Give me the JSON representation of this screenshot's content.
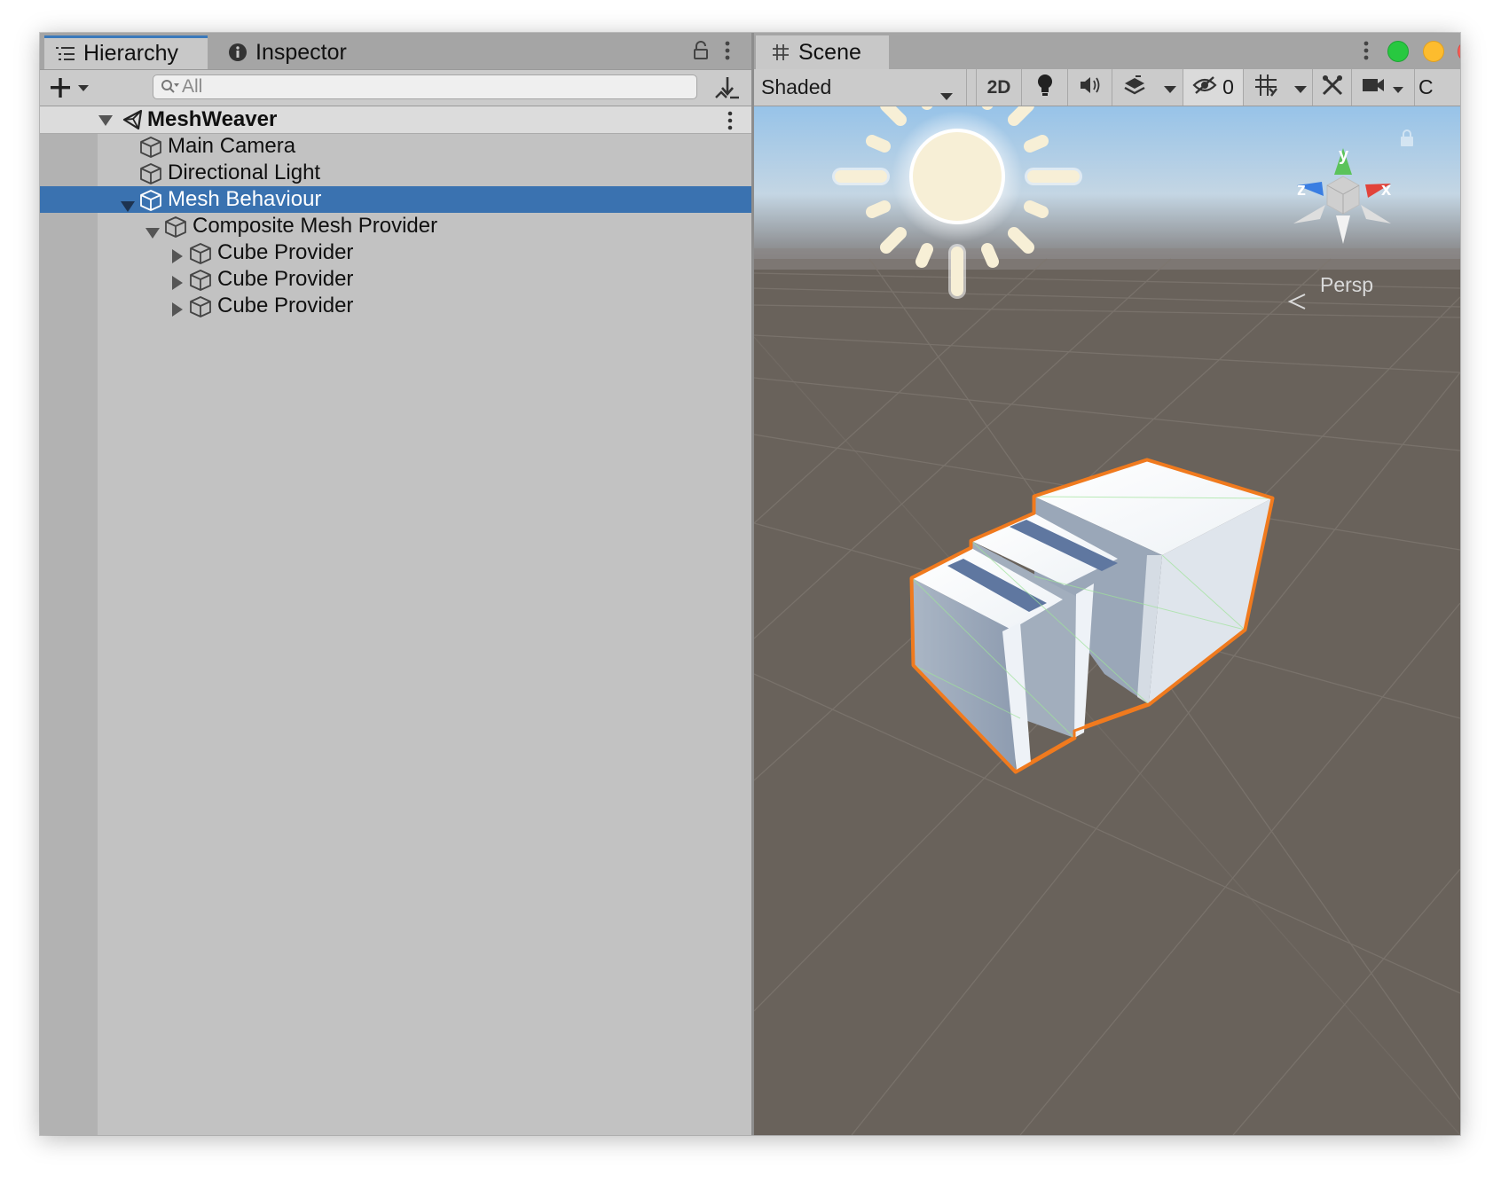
{
  "hierarchy_tab": {
    "label": "Hierarchy",
    "icon": "hierarchy-list-icon"
  },
  "inspector_tab": {
    "label": "Inspector",
    "icon": "info-icon"
  },
  "search": {
    "placeholder": "All"
  },
  "scene_tab": {
    "label": "Scene",
    "icon": "grid-icon"
  },
  "tree": {
    "scene_name": "MeshWeaver",
    "items": [
      {
        "label": "Main Camera"
      },
      {
        "label": "Directional Light"
      },
      {
        "label": "Mesh Behaviour",
        "selected": true,
        "expanded": true
      },
      {
        "label": "Composite Mesh Provider",
        "expanded": true
      },
      {
        "label": "Cube Provider",
        "expanded": false
      },
      {
        "label": "Cube Provider",
        "expanded": false
      },
      {
        "label": "Cube Provider",
        "expanded": false
      }
    ]
  },
  "scene_toolbar": {
    "draw_mode": "Shaded",
    "mode_2d": "2D",
    "hidden_count": "0",
    "cut_off": "C"
  },
  "viewport": {
    "projection_label": "Persp",
    "axis_y": "y",
    "axis_x": "x",
    "axis_z": "z"
  },
  "colors": {
    "selection": "#3a72b0",
    "tab_accent": "#3a79bb",
    "ground": "#69625b",
    "selection_outline": "#f07a1e",
    "close": "#fc5f57",
    "minimize": "#fdbc2e",
    "zoom": "#28c840"
  }
}
